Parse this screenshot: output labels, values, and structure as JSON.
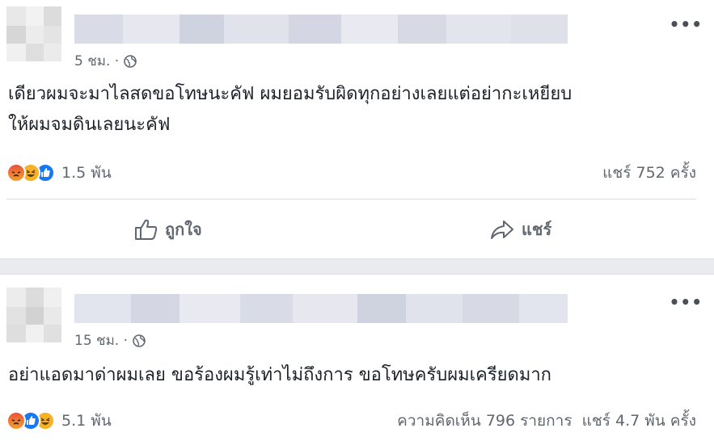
{
  "posts": [
    {
      "time": "5 ชม. ·",
      "text_line1": "เดียวผมจะมาไลสดขอโทษนะคัฟ ผมยอมรับผิดทุกอย่างเลยแต่อย่ากะเหยียบ",
      "text_line2": "ให้ผมจมดินเลยนะคัฟ",
      "reactions": [
        "angry",
        "haha",
        "like"
      ],
      "reaction_count": "1.5 พัน",
      "shares": "แชร์ 752 ครั้ง",
      "like_label": "ถูกใจ",
      "share_label": "แชร์"
    },
    {
      "time": "15 ชม. ·",
      "text_line1": "อย่าแอดมาด่าผมเลย ขอร้องผมรู้เท่าไม่ถึงการ ขอโทษครับผมเครียดมาก",
      "reactions": [
        "angry",
        "like",
        "haha"
      ],
      "reaction_count": "5.1 พัน",
      "stats": "ความคิดเห็น 796 รายการ  แชร์ 4.7 พัน ครั้ง"
    }
  ],
  "more_icon": "•••",
  "colors": {
    "like": "#1877f2",
    "angry": "#e9710f",
    "haha": "#f7b125",
    "text_secondary": "#616770"
  }
}
